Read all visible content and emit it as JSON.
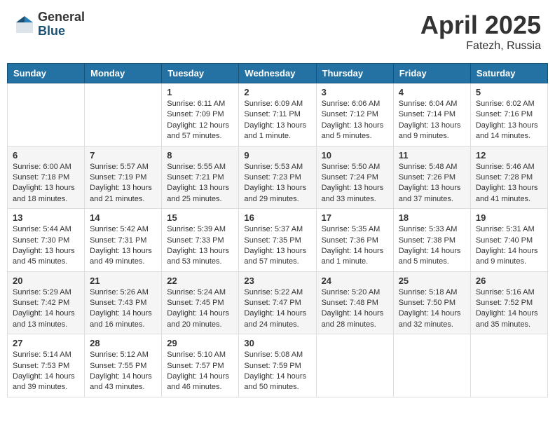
{
  "header": {
    "logo_general": "General",
    "logo_blue": "Blue",
    "month_title": "April 2025",
    "location": "Fatezh, Russia"
  },
  "days_of_week": [
    "Sunday",
    "Monday",
    "Tuesday",
    "Wednesday",
    "Thursday",
    "Friday",
    "Saturday"
  ],
  "weeks": [
    [
      {
        "day": "",
        "info": ""
      },
      {
        "day": "",
        "info": ""
      },
      {
        "day": "1",
        "info": "Sunrise: 6:11 AM\nSunset: 7:09 PM\nDaylight: 12 hours and 57 minutes."
      },
      {
        "day": "2",
        "info": "Sunrise: 6:09 AM\nSunset: 7:11 PM\nDaylight: 13 hours and 1 minute."
      },
      {
        "day": "3",
        "info": "Sunrise: 6:06 AM\nSunset: 7:12 PM\nDaylight: 13 hours and 5 minutes."
      },
      {
        "day": "4",
        "info": "Sunrise: 6:04 AM\nSunset: 7:14 PM\nDaylight: 13 hours and 9 minutes."
      },
      {
        "day": "5",
        "info": "Sunrise: 6:02 AM\nSunset: 7:16 PM\nDaylight: 13 hours and 14 minutes."
      }
    ],
    [
      {
        "day": "6",
        "info": "Sunrise: 6:00 AM\nSunset: 7:18 PM\nDaylight: 13 hours and 18 minutes."
      },
      {
        "day": "7",
        "info": "Sunrise: 5:57 AM\nSunset: 7:19 PM\nDaylight: 13 hours and 21 minutes."
      },
      {
        "day": "8",
        "info": "Sunrise: 5:55 AM\nSunset: 7:21 PM\nDaylight: 13 hours and 25 minutes."
      },
      {
        "day": "9",
        "info": "Sunrise: 5:53 AM\nSunset: 7:23 PM\nDaylight: 13 hours and 29 minutes."
      },
      {
        "day": "10",
        "info": "Sunrise: 5:50 AM\nSunset: 7:24 PM\nDaylight: 13 hours and 33 minutes."
      },
      {
        "day": "11",
        "info": "Sunrise: 5:48 AM\nSunset: 7:26 PM\nDaylight: 13 hours and 37 minutes."
      },
      {
        "day": "12",
        "info": "Sunrise: 5:46 AM\nSunset: 7:28 PM\nDaylight: 13 hours and 41 minutes."
      }
    ],
    [
      {
        "day": "13",
        "info": "Sunrise: 5:44 AM\nSunset: 7:30 PM\nDaylight: 13 hours and 45 minutes."
      },
      {
        "day": "14",
        "info": "Sunrise: 5:42 AM\nSunset: 7:31 PM\nDaylight: 13 hours and 49 minutes."
      },
      {
        "day": "15",
        "info": "Sunrise: 5:39 AM\nSunset: 7:33 PM\nDaylight: 13 hours and 53 minutes."
      },
      {
        "day": "16",
        "info": "Sunrise: 5:37 AM\nSunset: 7:35 PM\nDaylight: 13 hours and 57 minutes."
      },
      {
        "day": "17",
        "info": "Sunrise: 5:35 AM\nSunset: 7:36 PM\nDaylight: 14 hours and 1 minute."
      },
      {
        "day": "18",
        "info": "Sunrise: 5:33 AM\nSunset: 7:38 PM\nDaylight: 14 hours and 5 minutes."
      },
      {
        "day": "19",
        "info": "Sunrise: 5:31 AM\nSunset: 7:40 PM\nDaylight: 14 hours and 9 minutes."
      }
    ],
    [
      {
        "day": "20",
        "info": "Sunrise: 5:29 AM\nSunset: 7:42 PM\nDaylight: 14 hours and 13 minutes."
      },
      {
        "day": "21",
        "info": "Sunrise: 5:26 AM\nSunset: 7:43 PM\nDaylight: 14 hours and 16 minutes."
      },
      {
        "day": "22",
        "info": "Sunrise: 5:24 AM\nSunset: 7:45 PM\nDaylight: 14 hours and 20 minutes."
      },
      {
        "day": "23",
        "info": "Sunrise: 5:22 AM\nSunset: 7:47 PM\nDaylight: 14 hours and 24 minutes."
      },
      {
        "day": "24",
        "info": "Sunrise: 5:20 AM\nSunset: 7:48 PM\nDaylight: 14 hours and 28 minutes."
      },
      {
        "day": "25",
        "info": "Sunrise: 5:18 AM\nSunset: 7:50 PM\nDaylight: 14 hours and 32 minutes."
      },
      {
        "day": "26",
        "info": "Sunrise: 5:16 AM\nSunset: 7:52 PM\nDaylight: 14 hours and 35 minutes."
      }
    ],
    [
      {
        "day": "27",
        "info": "Sunrise: 5:14 AM\nSunset: 7:53 PM\nDaylight: 14 hours and 39 minutes."
      },
      {
        "day": "28",
        "info": "Sunrise: 5:12 AM\nSunset: 7:55 PM\nDaylight: 14 hours and 43 minutes."
      },
      {
        "day": "29",
        "info": "Sunrise: 5:10 AM\nSunset: 7:57 PM\nDaylight: 14 hours and 46 minutes."
      },
      {
        "day": "30",
        "info": "Sunrise: 5:08 AM\nSunset: 7:59 PM\nDaylight: 14 hours and 50 minutes."
      },
      {
        "day": "",
        "info": ""
      },
      {
        "day": "",
        "info": ""
      },
      {
        "day": "",
        "info": ""
      }
    ]
  ]
}
